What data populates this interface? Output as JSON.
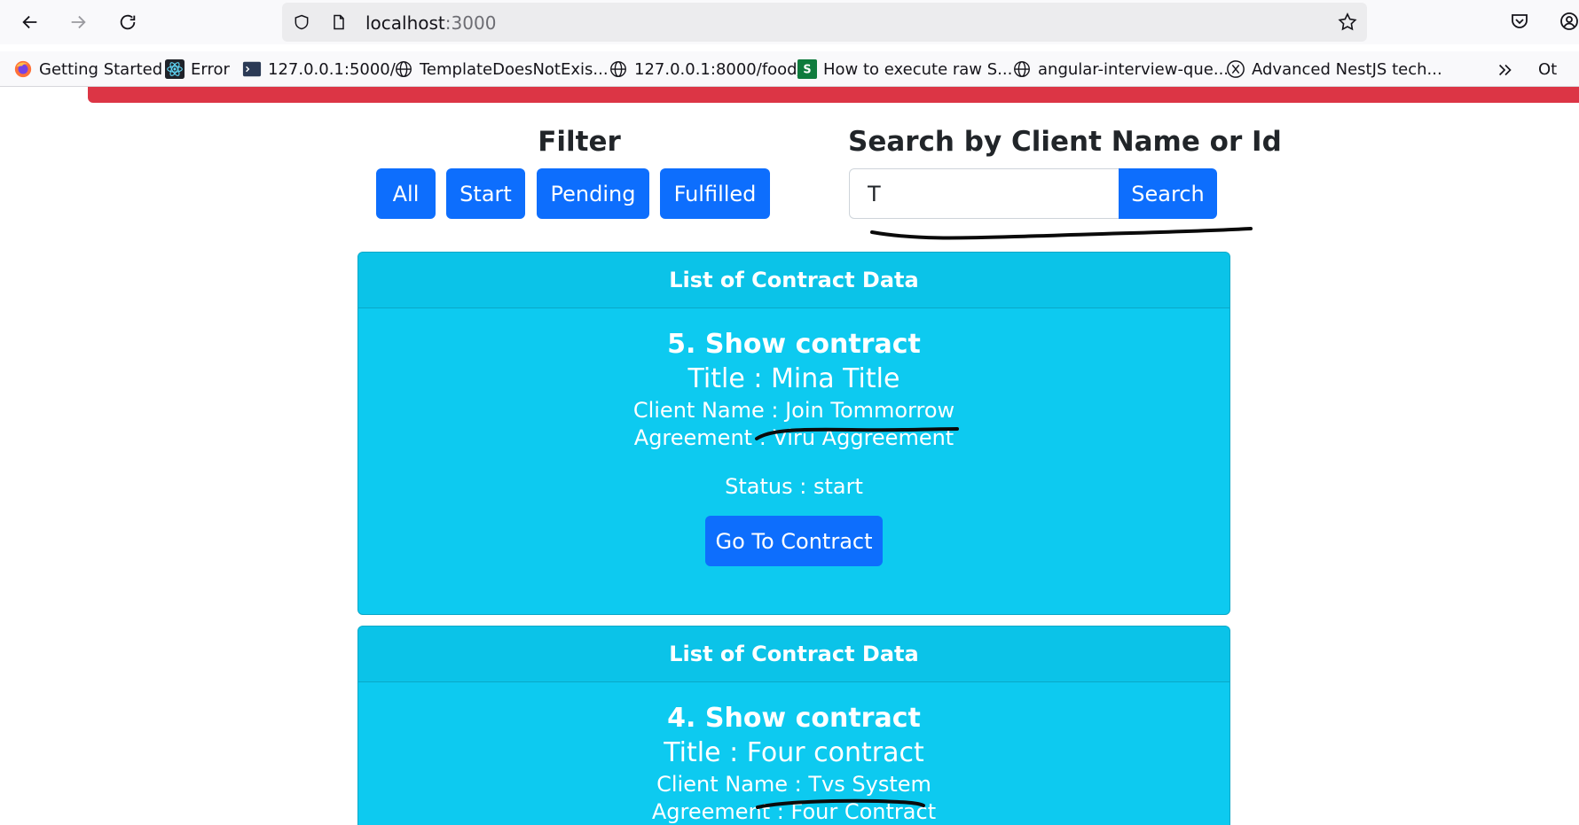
{
  "browser": {
    "url_host": "localhost",
    "url_port": ":3000",
    "bookmarks": [
      {
        "label": "Getting Started",
        "icon": "firefox-icon"
      },
      {
        "label": "Error",
        "icon": "react-icon"
      },
      {
        "label": "127.0.0.1:5000/",
        "icon": "terminal-icon"
      },
      {
        "label": "TemplateDoesNotExis...",
        "icon": "globe-icon"
      },
      {
        "label": "127.0.0.1:8000/food/",
        "icon": "globe-icon"
      },
      {
        "label": "How to execute raw S...",
        "icon": "s-icon"
      },
      {
        "label": "angular-interview-que...",
        "icon": "globe-icon"
      },
      {
        "label": "Advanced NestJS tech...",
        "icon": "x-icon"
      }
    ],
    "other_bookmarks_label": "Ot"
  },
  "filter": {
    "title": "Filter",
    "buttons": [
      "All",
      "Start",
      "Pending",
      "Fulfilled"
    ]
  },
  "search": {
    "title": "Search by Client Name or Id",
    "value": "T",
    "button_label": "Search"
  },
  "contracts": [
    {
      "header": "List of Contract Data",
      "heading": "5. Show contract",
      "title": "Title : Mina Title",
      "client": "Client Name : Join Tommorrow",
      "agreement": "Agreement : Viru Aggreement",
      "status": "Status : start",
      "button_label": "Go To Contract"
    },
    {
      "header": "List of Contract Data",
      "heading": "4. Show contract",
      "title": "Title : Four contract",
      "client": "Client Name : Tvs System",
      "agreement": "Agreement : Four Contract"
    }
  ],
  "colors": {
    "primary": "#0d6efd",
    "card": "#0dcaf0",
    "alert": "#dc3545"
  }
}
